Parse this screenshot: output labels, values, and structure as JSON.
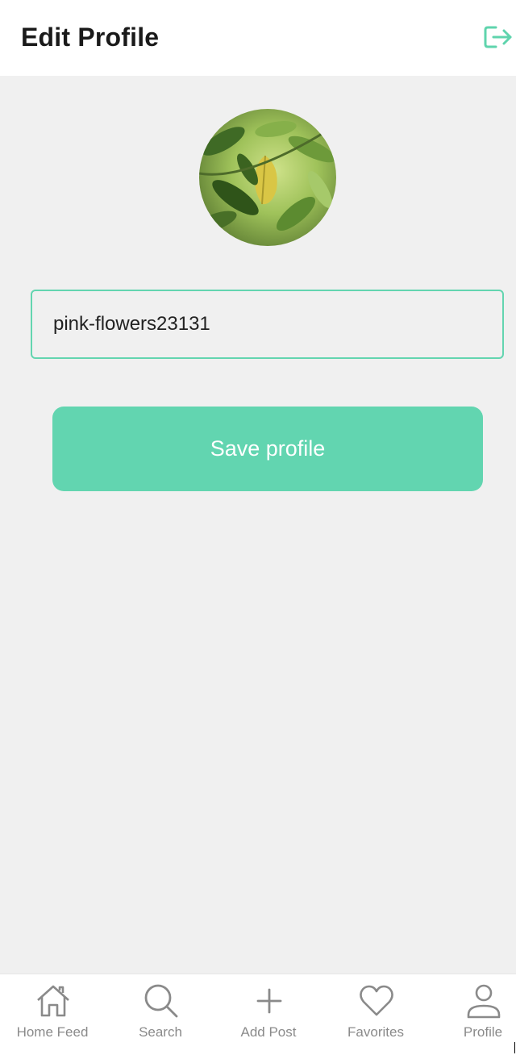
{
  "header": {
    "title": "Edit Profile",
    "logout_icon": "logout-icon",
    "accent_color": "#5fd4ad"
  },
  "profile": {
    "avatar_icon": "avatar-image",
    "username_value": "pink-flowers23131"
  },
  "actions": {
    "save_label": "Save profile",
    "save_color": "#62d5b0"
  },
  "tabbar": {
    "items": [
      {
        "label": "Home Feed",
        "icon": "home-icon"
      },
      {
        "label": "Search",
        "icon": "search-icon"
      },
      {
        "label": "Add Post",
        "icon": "plus-icon"
      },
      {
        "label": "Favorites",
        "icon": "heart-icon"
      },
      {
        "label": "Profile",
        "icon": "user-icon"
      }
    ]
  }
}
